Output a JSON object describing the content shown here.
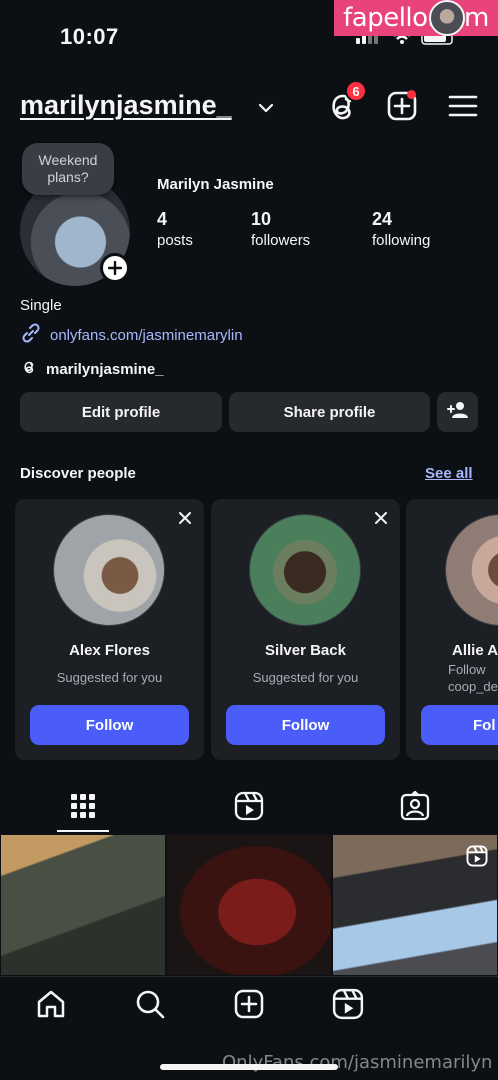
{
  "status_bar": {
    "time": "10:07"
  },
  "watermark": "fapello.com",
  "header": {
    "username": "marilynjasmine_",
    "threads_badge": "6"
  },
  "profile": {
    "note": "Weekend plans?",
    "display_name": "Marilyn Jasmine",
    "stats": [
      {
        "value": "4",
        "label": "posts"
      },
      {
        "value": "10",
        "label": "followers"
      },
      {
        "value": "24",
        "label": "following"
      }
    ],
    "bio": "Single",
    "link": "onlyfans.com/jasminemarylin",
    "threads_handle": "marilynjasmine_"
  },
  "actions": {
    "edit": "Edit profile",
    "share": "Share profile"
  },
  "discover": {
    "title": "Discover people",
    "see_all": "See all",
    "cards": [
      {
        "name": "Alex Flores",
        "subtitle": "Suggested for you",
        "button": "Follow"
      },
      {
        "name": "Silver Back",
        "subtitle": "Suggested for you",
        "button": "Follow"
      },
      {
        "name": "Allie A",
        "subtitle": "Follow coop_de",
        "button": "Fol"
      }
    ]
  },
  "footer_watermark": "OnlyFans.com/jasminemarilyn",
  "colors": {
    "background": "#0c1014",
    "accent_blue": "#4a5df9",
    "link": "#a8b8ff",
    "badge": "#ff3040",
    "watermark": "#e8437a"
  }
}
